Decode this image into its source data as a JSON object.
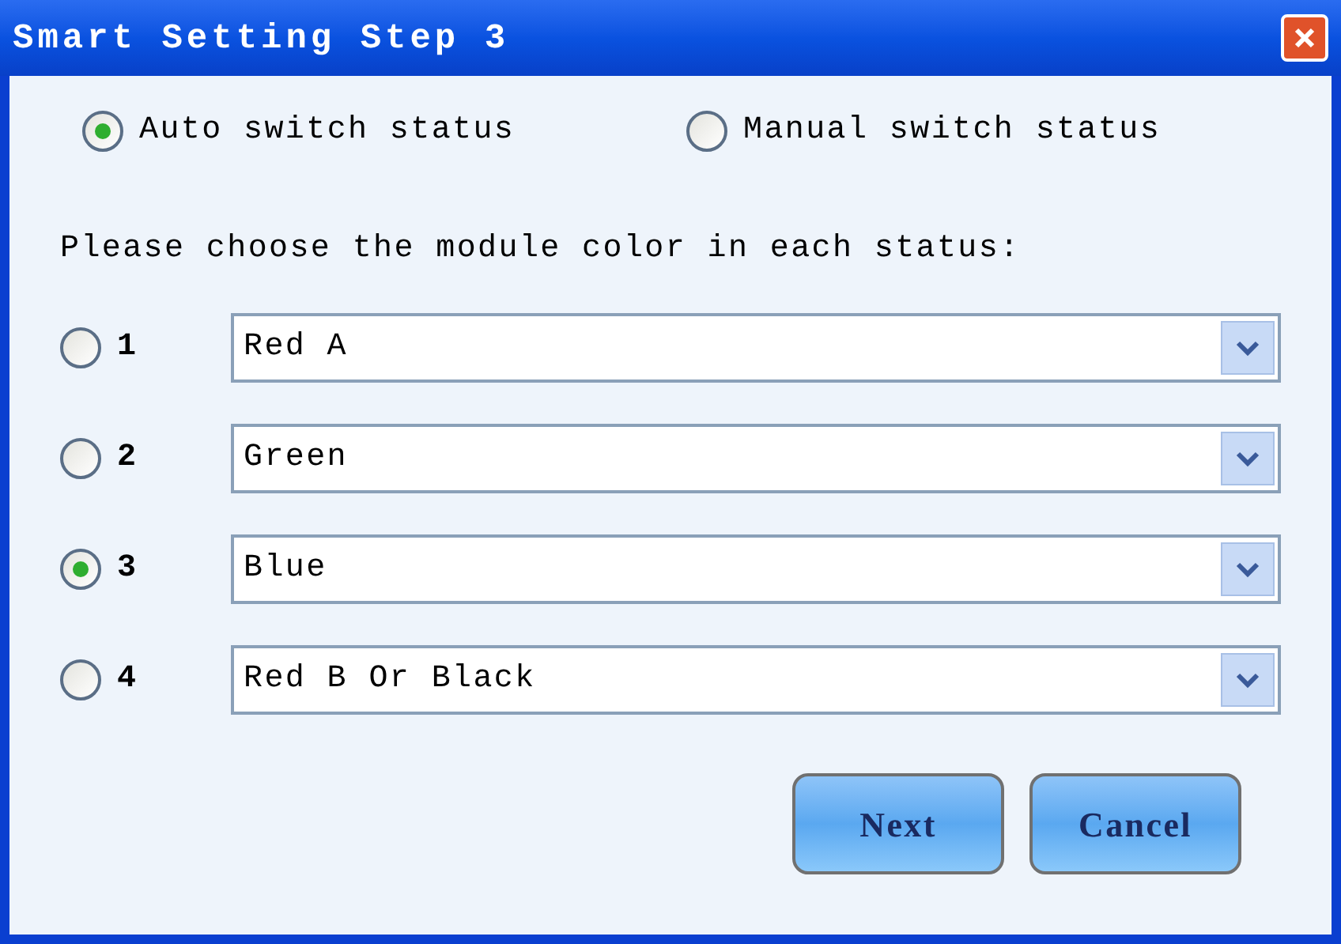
{
  "window": {
    "title": "Smart Setting Step 3"
  },
  "mode_options": [
    {
      "label": "Auto switch status",
      "selected": true
    },
    {
      "label": "Manual switch status",
      "selected": false
    }
  ],
  "instruction": "Please choose the module color in each status:",
  "statuses": [
    {
      "number": "1",
      "selected": false,
      "value": "Red A"
    },
    {
      "number": "2",
      "selected": false,
      "value": "Green"
    },
    {
      "number": "3",
      "selected": true,
      "value": "Blue"
    },
    {
      "number": "4",
      "selected": false,
      "value": "Red B Or Black"
    }
  ],
  "buttons": [
    "Next",
    "Cancel"
  ]
}
